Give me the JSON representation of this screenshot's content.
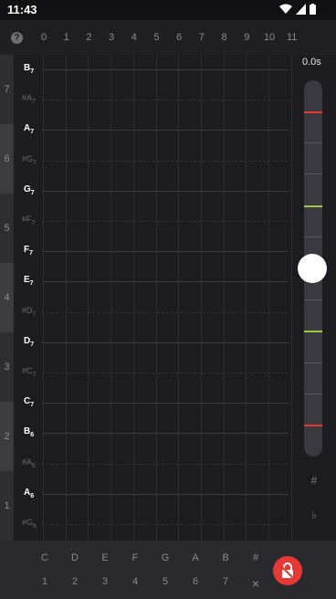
{
  "status": {
    "time": "11:43"
  },
  "header": {
    "help": "?",
    "columns": [
      "0",
      "1",
      "2",
      "3",
      "4",
      "5",
      "6",
      "7",
      "8",
      "9",
      "10",
      "11"
    ]
  },
  "octaves": [
    "7",
    "6",
    "5",
    "4",
    "3",
    "2",
    "1"
  ],
  "notes": [
    {
      "name": "B",
      "sub": "7",
      "sharp": false
    },
    {
      "name": "#A",
      "sub": "7",
      "sharp": true
    },
    {
      "name": "A",
      "sub": "7",
      "sharp": false
    },
    {
      "name": "#G",
      "sub": "7",
      "sharp": true
    },
    {
      "name": "G",
      "sub": "7",
      "sharp": false
    },
    {
      "name": "#F",
      "sub": "7",
      "sharp": true
    },
    {
      "name": "F",
      "sub": "7",
      "sharp": false
    },
    {
      "name": "E",
      "sub": "7",
      "sharp": false
    },
    {
      "name": "#D",
      "sub": "7",
      "sharp": true
    },
    {
      "name": "D",
      "sub": "7",
      "sharp": false
    },
    {
      "name": "#C",
      "sub": "7",
      "sharp": true
    },
    {
      "name": "C",
      "sub": "7",
      "sharp": false
    },
    {
      "name": "B",
      "sub": "6",
      "sharp": false
    },
    {
      "name": "#A",
      "sub": "6",
      "sharp": true
    },
    {
      "name": "A",
      "sub": "6",
      "sharp": false
    },
    {
      "name": "#G",
      "sub": "6",
      "sharp": true
    }
  ],
  "slider": {
    "time_label": "0.0s",
    "sharp_symbol": "#",
    "flat_symbol": "♭"
  },
  "bottom": {
    "note_keys": [
      "C",
      "D",
      "E",
      "F",
      "G",
      "A",
      "B",
      "#"
    ],
    "number_keys": [
      "1",
      "2",
      "3",
      "4",
      "5",
      "6",
      "7",
      "×"
    ]
  },
  "colors": {
    "accent_red": "#e53935",
    "accent_green": "#9ccc43",
    "background": "#1c1b1f"
  }
}
